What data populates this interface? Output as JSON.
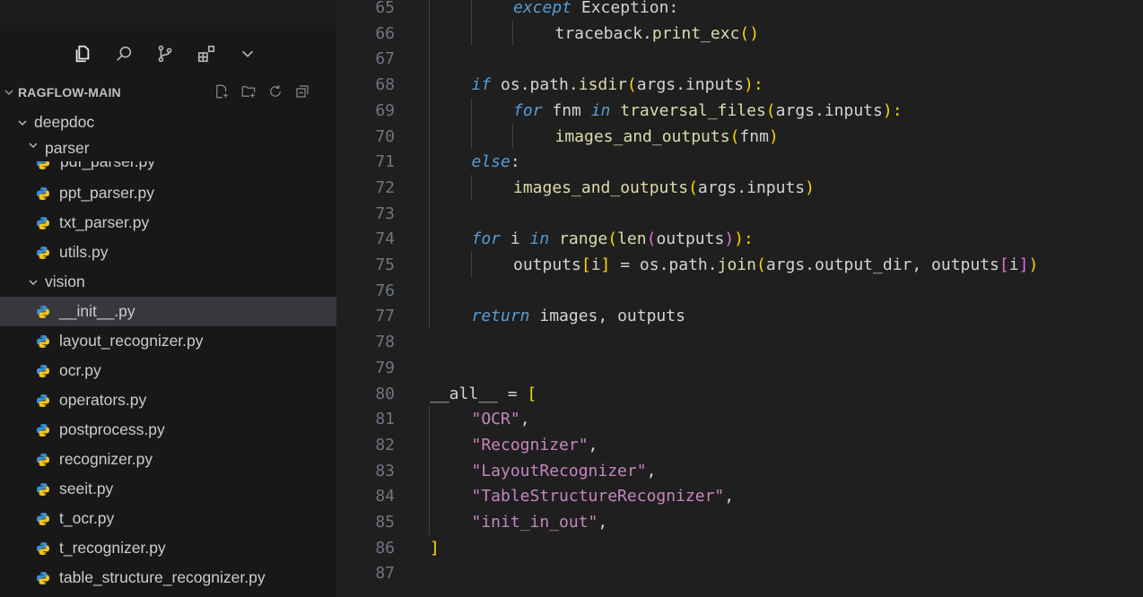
{
  "explorer": {
    "title": "RAGFLOW-MAIN"
  },
  "activitybar": {
    "icons": [
      "explorer-icon",
      "search-icon",
      "source-control-icon",
      "extensions-icon",
      "chevron-down-icon"
    ]
  },
  "tree": {
    "clipped_label": "pdf_parser.py",
    "items": [
      {
        "label": "deepdoc",
        "type": "folder",
        "depth": 0
      },
      {
        "label": "parser",
        "type": "folder",
        "depth": 1
      },
      {
        "label": "ppt_parser.py",
        "type": "file",
        "depth": 2
      },
      {
        "label": "txt_parser.py",
        "type": "file",
        "depth": 2
      },
      {
        "label": "utils.py",
        "type": "file",
        "depth": 2
      },
      {
        "label": "vision",
        "type": "folder",
        "depth": 1
      },
      {
        "label": "__init__.py",
        "type": "file",
        "depth": 2,
        "selected": true
      },
      {
        "label": "layout_recognizer.py",
        "type": "file",
        "depth": 2
      },
      {
        "label": "ocr.py",
        "type": "file",
        "depth": 2
      },
      {
        "label": "operators.py",
        "type": "file",
        "depth": 2
      },
      {
        "label": "postprocess.py",
        "type": "file",
        "depth": 2
      },
      {
        "label": "recognizer.py",
        "type": "file",
        "depth": 2
      },
      {
        "label": "seeit.py",
        "type": "file",
        "depth": 2
      },
      {
        "label": "t_ocr.py",
        "type": "file",
        "depth": 2
      },
      {
        "label": "t_recognizer.py",
        "type": "file",
        "depth": 2
      },
      {
        "label": "table_structure_recognizer.py",
        "type": "file",
        "depth": 2
      }
    ]
  },
  "editor": {
    "lines": [
      {
        "n": "65",
        "indent": 2,
        "tokens": [
          [
            "kw",
            "except"
          ],
          [
            "var",
            " Exception:"
          ]
        ]
      },
      {
        "n": "66",
        "indent": 3,
        "tokens": [
          [
            "var",
            "traceback."
          ],
          [
            "fn",
            "print_exc"
          ],
          [
            "bk1",
            "()"
          ]
        ]
      },
      {
        "n": "67",
        "indent": 0,
        "tokens": []
      },
      {
        "n": "68",
        "indent": 1,
        "tokens": [
          [
            "kw",
            "if"
          ],
          [
            "var",
            " os.path."
          ],
          [
            "fn",
            "isdir"
          ],
          [
            "bk1",
            "("
          ],
          [
            "var",
            "args.inputs"
          ],
          [
            "bk1",
            "):"
          ]
        ]
      },
      {
        "n": "69",
        "indent": 2,
        "tokens": [
          [
            "kw",
            "for"
          ],
          [
            "var",
            " fnm "
          ],
          [
            "kw",
            "in"
          ],
          [
            "var",
            " "
          ],
          [
            "fn",
            "traversal_files"
          ],
          [
            "bk1",
            "("
          ],
          [
            "var",
            "args.inputs"
          ],
          [
            "bk1",
            "):"
          ]
        ]
      },
      {
        "n": "70",
        "indent": 3,
        "tokens": [
          [
            "fn",
            "images_and_outputs"
          ],
          [
            "bk1",
            "("
          ],
          [
            "var",
            "fnm"
          ],
          [
            "bk1",
            ")"
          ]
        ]
      },
      {
        "n": "71",
        "indent": 1,
        "tokens": [
          [
            "kw",
            "else"
          ],
          [
            "var",
            ":"
          ]
        ]
      },
      {
        "n": "72",
        "indent": 2,
        "tokens": [
          [
            "fn",
            "images_and_outputs"
          ],
          [
            "bk1",
            "("
          ],
          [
            "var",
            "args.inputs"
          ],
          [
            "bk1",
            ")"
          ]
        ]
      },
      {
        "n": "73",
        "indent": 0,
        "tokens": []
      },
      {
        "n": "74",
        "indent": 1,
        "tokens": [
          [
            "kw",
            "for"
          ],
          [
            "var",
            " i "
          ],
          [
            "kw",
            "in"
          ],
          [
            "var",
            " "
          ],
          [
            "fn",
            "range"
          ],
          [
            "bk1",
            "("
          ],
          [
            "fn",
            "len"
          ],
          [
            "bk2",
            "("
          ],
          [
            "var",
            "outputs"
          ],
          [
            "bk2",
            ")"
          ],
          [
            "bk1",
            "):"
          ]
        ]
      },
      {
        "n": "75",
        "indent": 2,
        "tokens": [
          [
            "var",
            "outputs"
          ],
          [
            "bk1",
            "["
          ],
          [
            "var",
            "i"
          ],
          [
            "bk1",
            "]"
          ],
          [
            "var",
            " = os.path."
          ],
          [
            "fn",
            "join"
          ],
          [
            "bk1",
            "("
          ],
          [
            "var",
            "args.output_dir, outputs"
          ],
          [
            "bk2",
            "["
          ],
          [
            "var",
            "i"
          ],
          [
            "bk2",
            "]"
          ],
          [
            "bk1",
            ")"
          ]
        ]
      },
      {
        "n": "76",
        "indent": 0,
        "tokens": []
      },
      {
        "n": "77",
        "indent": 1,
        "tokens": [
          [
            "kw",
            "return"
          ],
          [
            "var",
            " images, outputs"
          ]
        ]
      },
      {
        "n": "78",
        "indent": 0,
        "tokens": []
      },
      {
        "n": "79",
        "indent": 0,
        "tokens": []
      },
      {
        "n": "80",
        "indent": 0,
        "tokens": [
          [
            "var",
            "__all__ = "
          ],
          [
            "bk1",
            "["
          ]
        ]
      },
      {
        "n": "81",
        "indent": 1,
        "tokens": [
          [
            "mag",
            "\"OCR\""
          ],
          [
            "var",
            ","
          ]
        ]
      },
      {
        "n": "82",
        "indent": 1,
        "tokens": [
          [
            "mag",
            "\"Recognizer\""
          ],
          [
            "var",
            ","
          ]
        ]
      },
      {
        "n": "83",
        "indent": 1,
        "tokens": [
          [
            "mag",
            "\"LayoutRecognizer\""
          ],
          [
            "var",
            ","
          ]
        ]
      },
      {
        "n": "84",
        "indent": 1,
        "tokens": [
          [
            "mag",
            "\"TableStructureRecognizer\""
          ],
          [
            "var",
            ","
          ]
        ]
      },
      {
        "n": "85",
        "indent": 1,
        "tokens": [
          [
            "mag",
            "\"init_in_out\""
          ],
          [
            "var",
            ","
          ]
        ]
      },
      {
        "n": "86",
        "indent": 0,
        "tokens": [
          [
            "bk1",
            "]"
          ]
        ]
      },
      {
        "n": "87",
        "indent": 0,
        "tokens": []
      }
    ]
  },
  "colors": {
    "sidebar_bg": "#181818",
    "editor_bg": "#1f1f1f",
    "selected_row": "#37373d",
    "python_icon": "#3b8fd6"
  }
}
